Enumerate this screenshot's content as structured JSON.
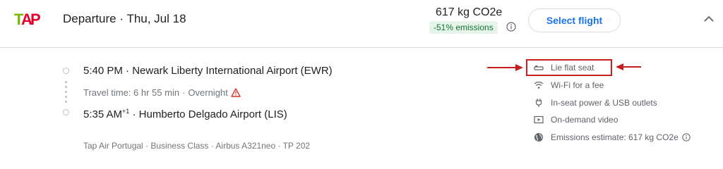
{
  "header": {
    "airline_logo": "tap-air-portugal-logo",
    "departure_label": "Departure",
    "separator": "·",
    "date": "Thu, Jul 18",
    "emissions_value": "617 kg CO2e",
    "emissions_badge": "-51% emissions",
    "select_button": "Select flight"
  },
  "itinerary": {
    "departure": {
      "time": "5:40 PM",
      "airport": "Newark Liberty International Airport (EWR)"
    },
    "travel": {
      "duration": "Travel time: 6 hr 55 min",
      "overnight": "Overnight"
    },
    "arrival": {
      "time": "5:35 AM",
      "day_offset": "+1",
      "airport": "Humberto Delgado Airport (LIS)"
    },
    "details": "Tap Air Portugal · Business Class · Airbus A321neo · TP 202"
  },
  "amenities": [
    {
      "icon": "lie-flat-seat-icon",
      "label": "Lie flat seat"
    },
    {
      "icon": "wifi-icon",
      "label": "Wi-Fi for a fee"
    },
    {
      "icon": "power-plug-icon",
      "label": "In-seat power & USB outlets"
    },
    {
      "icon": "video-icon",
      "label": "On-demand video"
    },
    {
      "icon": "globe-icon",
      "label": "Emissions estimate: 617 kg CO2e"
    }
  ],
  "colors": {
    "accent": "#1a73e8",
    "annotation_red": "#c81e1e",
    "emissions_green": "#137333",
    "warning_red": "#d93025",
    "tap_red": "#e4002b",
    "tap_green": "#7ab800"
  }
}
